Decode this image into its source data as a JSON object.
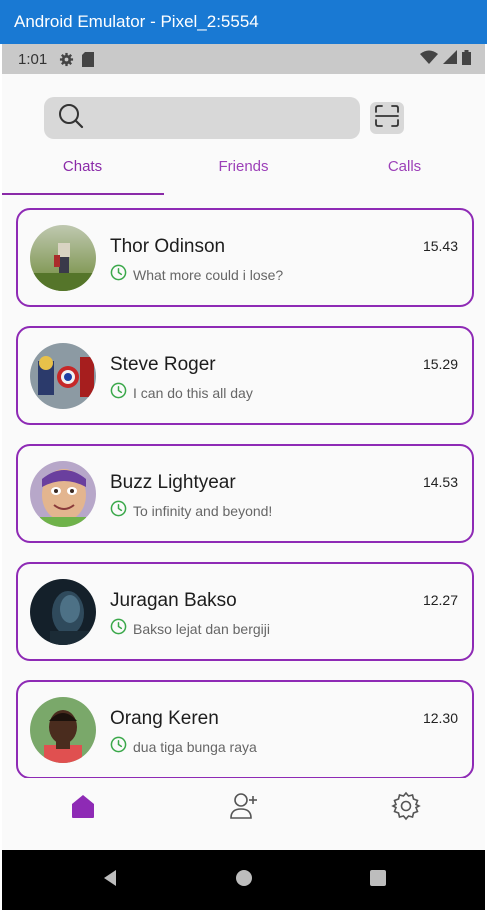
{
  "window": {
    "title": "Android Emulator - Pixel_2:5554"
  },
  "status_bar": {
    "time": "1:01",
    "icons": [
      "gear-icon",
      "sd-card-icon",
      "wifi-icon",
      "signal-icon",
      "battery-icon"
    ]
  },
  "search": {
    "value": "",
    "placeholder": ""
  },
  "tabs": [
    {
      "label": "Chats",
      "active": true
    },
    {
      "label": "Friends",
      "active": false
    },
    {
      "label": "Calls",
      "active": false
    }
  ],
  "chats": [
    {
      "name": "Thor Odinson",
      "message": "What more could i lose?",
      "time": "15.43"
    },
    {
      "name": "Steve Roger",
      "message": "I can do this all day",
      "time": "15.29"
    },
    {
      "name": "Buzz Lightyear",
      "message": "To infinity and beyond!",
      "time": "14.53"
    },
    {
      "name": "Juragan Bakso",
      "message": "Bakso lejat dan bergiji",
      "time": "12.27"
    },
    {
      "name": "Orang Keren",
      "message": "dua tiga bunga raya",
      "time": "12.30"
    }
  ],
  "bottom_nav": [
    {
      "icon": "home-icon",
      "active": true
    },
    {
      "icon": "add-friend-icon",
      "active": false
    },
    {
      "icon": "settings-icon",
      "active": false
    }
  ],
  "colors": {
    "accent": "#8e2ab5",
    "clock": "#3aa84a",
    "titlebar": "#1979d3"
  }
}
